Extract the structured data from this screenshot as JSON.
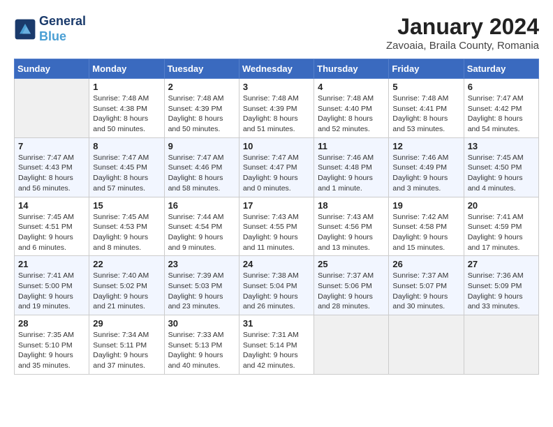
{
  "logo": {
    "line1": "General",
    "line2": "Blue"
  },
  "title": "January 2024",
  "subtitle": "Zavoaia, Braila County, Romania",
  "weekdays": [
    "Sunday",
    "Monday",
    "Tuesday",
    "Wednesday",
    "Thursday",
    "Friday",
    "Saturday"
  ],
  "weeks": [
    [
      {
        "day": "",
        "sunrise": "",
        "sunset": "",
        "daylight": ""
      },
      {
        "day": "1",
        "sunrise": "Sunrise: 7:48 AM",
        "sunset": "Sunset: 4:38 PM",
        "daylight": "Daylight: 8 hours and 50 minutes."
      },
      {
        "day": "2",
        "sunrise": "Sunrise: 7:48 AM",
        "sunset": "Sunset: 4:39 PM",
        "daylight": "Daylight: 8 hours and 50 minutes."
      },
      {
        "day": "3",
        "sunrise": "Sunrise: 7:48 AM",
        "sunset": "Sunset: 4:39 PM",
        "daylight": "Daylight: 8 hours and 51 minutes."
      },
      {
        "day": "4",
        "sunrise": "Sunrise: 7:48 AM",
        "sunset": "Sunset: 4:40 PM",
        "daylight": "Daylight: 8 hours and 52 minutes."
      },
      {
        "day": "5",
        "sunrise": "Sunrise: 7:48 AM",
        "sunset": "Sunset: 4:41 PM",
        "daylight": "Daylight: 8 hours and 53 minutes."
      },
      {
        "day": "6",
        "sunrise": "Sunrise: 7:47 AM",
        "sunset": "Sunset: 4:42 PM",
        "daylight": "Daylight: 8 hours and 54 minutes."
      }
    ],
    [
      {
        "day": "7",
        "sunrise": "Sunrise: 7:47 AM",
        "sunset": "Sunset: 4:43 PM",
        "daylight": "Daylight: 8 hours and 56 minutes."
      },
      {
        "day": "8",
        "sunrise": "Sunrise: 7:47 AM",
        "sunset": "Sunset: 4:45 PM",
        "daylight": "Daylight: 8 hours and 57 minutes."
      },
      {
        "day": "9",
        "sunrise": "Sunrise: 7:47 AM",
        "sunset": "Sunset: 4:46 PM",
        "daylight": "Daylight: 8 hours and 58 minutes."
      },
      {
        "day": "10",
        "sunrise": "Sunrise: 7:47 AM",
        "sunset": "Sunset: 4:47 PM",
        "daylight": "Daylight: 9 hours and 0 minutes."
      },
      {
        "day": "11",
        "sunrise": "Sunrise: 7:46 AM",
        "sunset": "Sunset: 4:48 PM",
        "daylight": "Daylight: 9 hours and 1 minute."
      },
      {
        "day": "12",
        "sunrise": "Sunrise: 7:46 AM",
        "sunset": "Sunset: 4:49 PM",
        "daylight": "Daylight: 9 hours and 3 minutes."
      },
      {
        "day": "13",
        "sunrise": "Sunrise: 7:45 AM",
        "sunset": "Sunset: 4:50 PM",
        "daylight": "Daylight: 9 hours and 4 minutes."
      }
    ],
    [
      {
        "day": "14",
        "sunrise": "Sunrise: 7:45 AM",
        "sunset": "Sunset: 4:51 PM",
        "daylight": "Daylight: 9 hours and 6 minutes."
      },
      {
        "day": "15",
        "sunrise": "Sunrise: 7:45 AM",
        "sunset": "Sunset: 4:53 PM",
        "daylight": "Daylight: 9 hours and 8 minutes."
      },
      {
        "day": "16",
        "sunrise": "Sunrise: 7:44 AM",
        "sunset": "Sunset: 4:54 PM",
        "daylight": "Daylight: 9 hours and 9 minutes."
      },
      {
        "day": "17",
        "sunrise": "Sunrise: 7:43 AM",
        "sunset": "Sunset: 4:55 PM",
        "daylight": "Daylight: 9 hours and 11 minutes."
      },
      {
        "day": "18",
        "sunrise": "Sunrise: 7:43 AM",
        "sunset": "Sunset: 4:56 PM",
        "daylight": "Daylight: 9 hours and 13 minutes."
      },
      {
        "day": "19",
        "sunrise": "Sunrise: 7:42 AM",
        "sunset": "Sunset: 4:58 PM",
        "daylight": "Daylight: 9 hours and 15 minutes."
      },
      {
        "day": "20",
        "sunrise": "Sunrise: 7:41 AM",
        "sunset": "Sunset: 4:59 PM",
        "daylight": "Daylight: 9 hours and 17 minutes."
      }
    ],
    [
      {
        "day": "21",
        "sunrise": "Sunrise: 7:41 AM",
        "sunset": "Sunset: 5:00 PM",
        "daylight": "Daylight: 9 hours and 19 minutes."
      },
      {
        "day": "22",
        "sunrise": "Sunrise: 7:40 AM",
        "sunset": "Sunset: 5:02 PM",
        "daylight": "Daylight: 9 hours and 21 minutes."
      },
      {
        "day": "23",
        "sunrise": "Sunrise: 7:39 AM",
        "sunset": "Sunset: 5:03 PM",
        "daylight": "Daylight: 9 hours and 23 minutes."
      },
      {
        "day": "24",
        "sunrise": "Sunrise: 7:38 AM",
        "sunset": "Sunset: 5:04 PM",
        "daylight": "Daylight: 9 hours and 26 minutes."
      },
      {
        "day": "25",
        "sunrise": "Sunrise: 7:37 AM",
        "sunset": "Sunset: 5:06 PM",
        "daylight": "Daylight: 9 hours and 28 minutes."
      },
      {
        "day": "26",
        "sunrise": "Sunrise: 7:37 AM",
        "sunset": "Sunset: 5:07 PM",
        "daylight": "Daylight: 9 hours and 30 minutes."
      },
      {
        "day": "27",
        "sunrise": "Sunrise: 7:36 AM",
        "sunset": "Sunset: 5:09 PM",
        "daylight": "Daylight: 9 hours and 33 minutes."
      }
    ],
    [
      {
        "day": "28",
        "sunrise": "Sunrise: 7:35 AM",
        "sunset": "Sunset: 5:10 PM",
        "daylight": "Daylight: 9 hours and 35 minutes."
      },
      {
        "day": "29",
        "sunrise": "Sunrise: 7:34 AM",
        "sunset": "Sunset: 5:11 PM",
        "daylight": "Daylight: 9 hours and 37 minutes."
      },
      {
        "day": "30",
        "sunrise": "Sunrise: 7:33 AM",
        "sunset": "Sunset: 5:13 PM",
        "daylight": "Daylight: 9 hours and 40 minutes."
      },
      {
        "day": "31",
        "sunrise": "Sunrise: 7:31 AM",
        "sunset": "Sunset: 5:14 PM",
        "daylight": "Daylight: 9 hours and 42 minutes."
      },
      {
        "day": "",
        "sunrise": "",
        "sunset": "",
        "daylight": ""
      },
      {
        "day": "",
        "sunrise": "",
        "sunset": "",
        "daylight": ""
      },
      {
        "day": "",
        "sunrise": "",
        "sunset": "",
        "daylight": ""
      }
    ]
  ]
}
